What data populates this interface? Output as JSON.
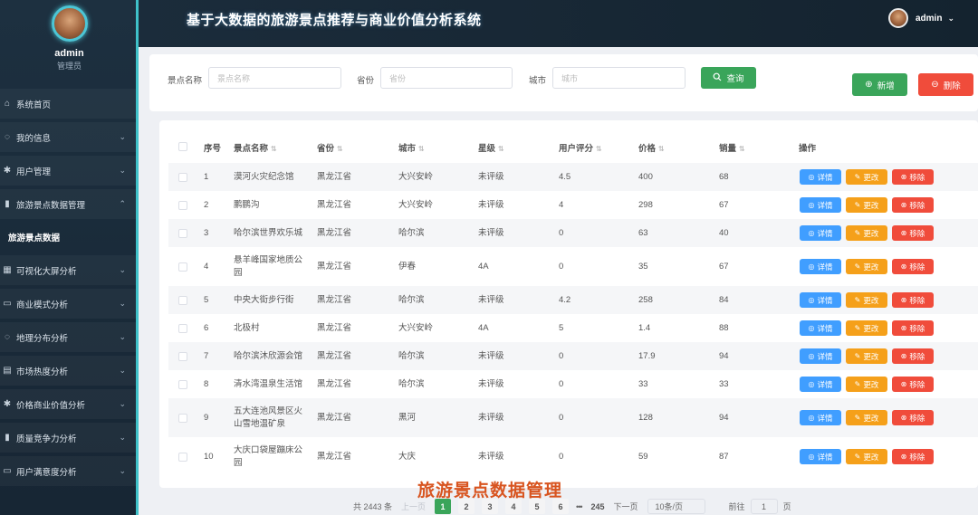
{
  "app": {
    "title": "基于大数据的旅游景点推荐与商业价值分析系统"
  },
  "user": {
    "name": "admin",
    "role": "管理员"
  },
  "sidebar": {
    "items": [
      {
        "label": "系统首页",
        "icon": "home-icon"
      },
      {
        "label": "我的信息",
        "icon": "user-icon"
      },
      {
        "label": "用户管理",
        "icon": "gear-icon"
      },
      {
        "label": "旅游景点数据管理",
        "icon": "bar-chart-icon"
      },
      {
        "label": "可视化大屏分析",
        "icon": "calendar-icon"
      },
      {
        "label": "商业模式分析",
        "icon": "monitor-icon"
      },
      {
        "label": "地理分布分析",
        "icon": "user-icon"
      },
      {
        "label": "市场热度分析",
        "icon": "shop-icon"
      },
      {
        "label": "价格商业价值分析",
        "icon": "gear-icon"
      },
      {
        "label": "质量竞争力分析",
        "icon": "bar-chart-icon"
      },
      {
        "label": "用户满意度分析",
        "icon": "monitor-icon"
      }
    ],
    "active_sub": "旅游景点数据"
  },
  "search": {
    "name_label": "景点名称",
    "name_placeholder": "景点名称",
    "province_label": "省份",
    "province_placeholder": "省份",
    "city_label": "城市",
    "city_placeholder": "城市",
    "query_label": "查询"
  },
  "actions": {
    "add_label": "新增",
    "delete_label": "删除"
  },
  "table": {
    "headers": {
      "index": "序号",
      "name": "景点名称",
      "province": "省份",
      "city": "城市",
      "star": "星级",
      "rating": "用户评分",
      "price": "价格",
      "sales": "销量",
      "ops": "操作"
    },
    "op_labels": {
      "detail": "详情",
      "edit": "更改",
      "remove": "移除"
    },
    "rows": [
      {
        "index": "1",
        "name": "漠河火灾纪念馆",
        "province": "黑龙江省",
        "city": "大兴安岭",
        "star": "未评级",
        "rating": "4.5",
        "price": "400",
        "sales": "68"
      },
      {
        "index": "2",
        "name": "鹏鹏沟",
        "province": "黑龙江省",
        "city": "大兴安岭",
        "star": "未评级",
        "rating": "4",
        "price": "298",
        "sales": "67"
      },
      {
        "index": "3",
        "name": "哈尔滨世界欢乐城",
        "province": "黑龙江省",
        "city": "哈尔滨",
        "star": "未评级",
        "rating": "0",
        "price": "63",
        "sales": "40"
      },
      {
        "index": "4",
        "name": "悬羊峰国家地质公园",
        "province": "黑龙江省",
        "city": "伊春",
        "star": "4A",
        "rating": "0",
        "price": "35",
        "sales": "67"
      },
      {
        "index": "5",
        "name": "中央大街步行街",
        "province": "黑龙江省",
        "city": "哈尔滨",
        "star": "未评级",
        "rating": "4.2",
        "price": "258",
        "sales": "84"
      },
      {
        "index": "6",
        "name": "北极村",
        "province": "黑龙江省",
        "city": "大兴安岭",
        "star": "4A",
        "rating": "5",
        "price": "1.4",
        "sales": "88"
      },
      {
        "index": "7",
        "name": "哈尔滨沐欣源会馆",
        "province": "黑龙江省",
        "city": "哈尔滨",
        "star": "未评级",
        "rating": "0",
        "price": "17.9",
        "sales": "94"
      },
      {
        "index": "8",
        "name": "清水湾温泉生活馆",
        "province": "黑龙江省",
        "city": "哈尔滨",
        "star": "未评级",
        "rating": "0",
        "price": "33",
        "sales": "33"
      },
      {
        "index": "9",
        "name": "五大连池风景区火山雪地温矿泉",
        "province": "黑龙江省",
        "city": "黑河",
        "star": "未评级",
        "rating": "0",
        "price": "128",
        "sales": "94"
      },
      {
        "index": "10",
        "name": "大庆口袋屋蹦床公园",
        "province": "黑龙江省",
        "city": "大庆",
        "star": "未评级",
        "rating": "0",
        "price": "59",
        "sales": "87"
      }
    ]
  },
  "pagination": {
    "total": "共 2443 条",
    "prev": "上一页",
    "next": "下一页",
    "pages": [
      "1",
      "2",
      "3",
      "4",
      "5",
      "6"
    ],
    "ellipsis": "•••",
    "last": "245",
    "page_size": "10条/页",
    "goto_label": "前往",
    "goto_value": "1",
    "goto_suffix": "页"
  },
  "watermark": "旅游景点数据管理"
}
